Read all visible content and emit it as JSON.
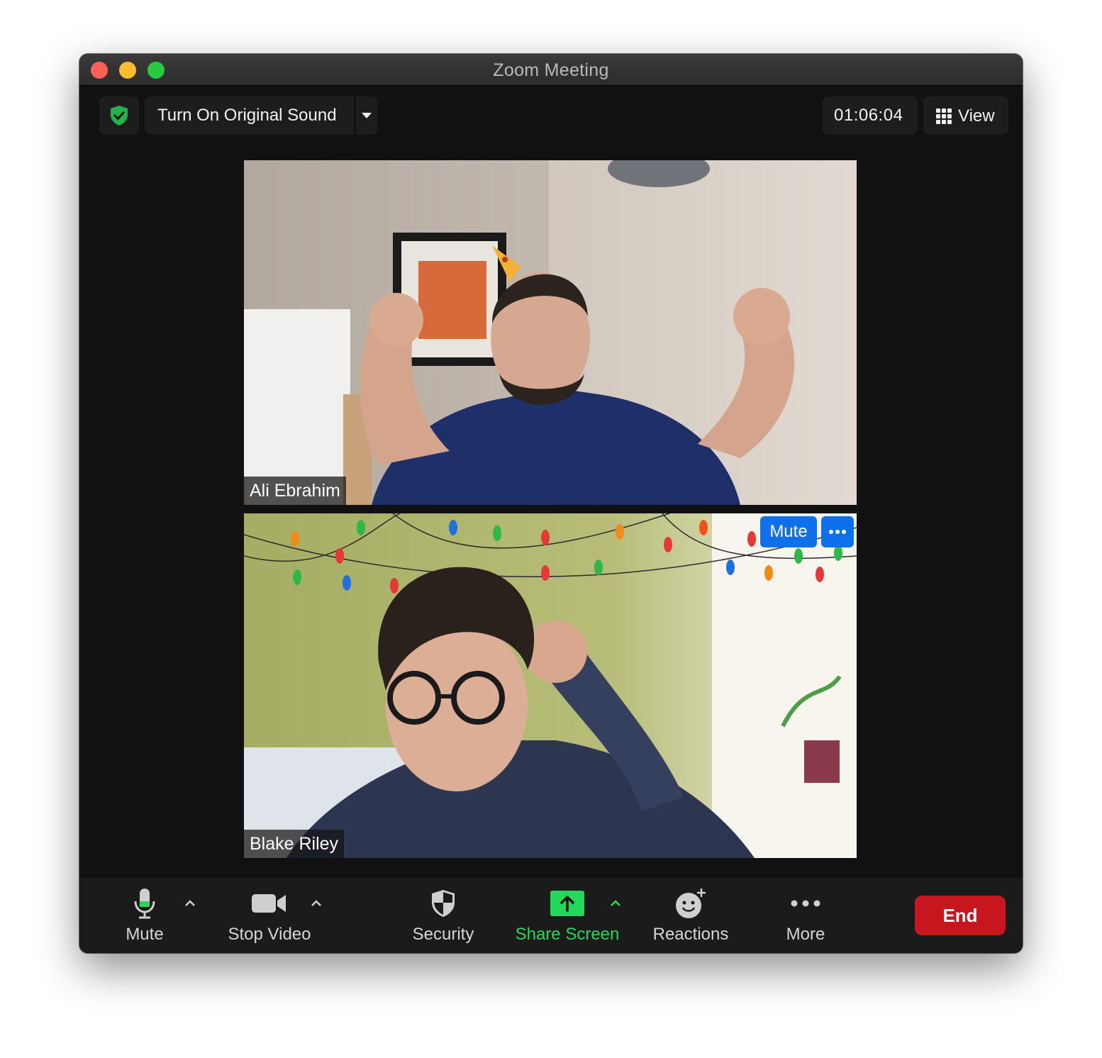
{
  "window": {
    "title": "Zoom Meeting"
  },
  "topbar": {
    "original_sound_label": "Turn On Original Sound",
    "timer": "01:06:04",
    "view_label": "View",
    "security_shield_color": "#24b24a"
  },
  "participants": [
    {
      "name": "Ali Ebrahim"
    },
    {
      "name": "Blake Riley",
      "mute_button": "Mute"
    }
  ],
  "toolbar": {
    "mute": "Mute",
    "stop_video": "Stop Video",
    "security": "Security",
    "share_screen": "Share Screen",
    "reactions": "Reactions",
    "more": "More",
    "end": "End",
    "share_color": "#23d959",
    "end_color": "#c7161e"
  },
  "icons": [
    "security-shield-icon",
    "dropdown-caret-icon",
    "grid-icon",
    "microphone-icon",
    "video-camera-icon",
    "shield-icon",
    "share-arrow-icon",
    "add-reaction-icon",
    "more-dots-icon"
  ]
}
